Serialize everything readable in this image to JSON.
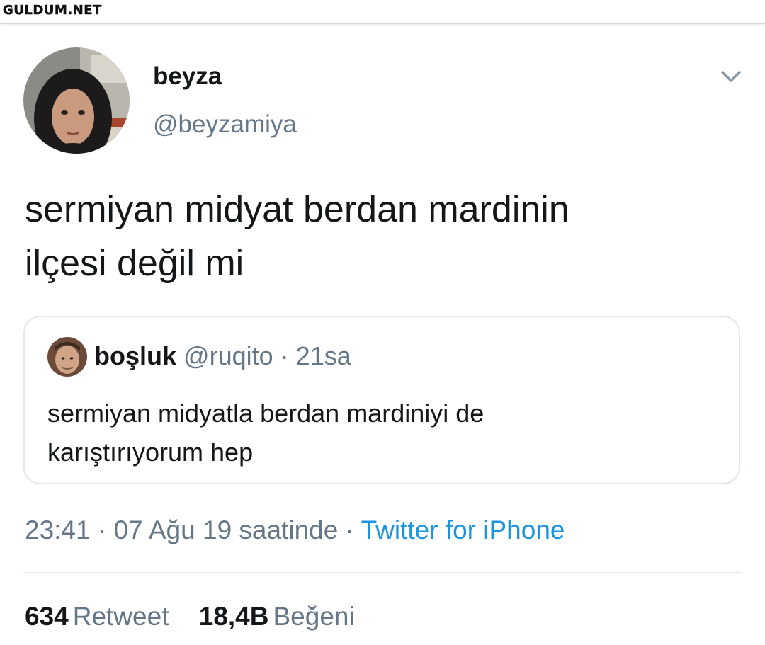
{
  "watermark": {
    "text": "GULDUM.NET"
  },
  "tweet": {
    "author": {
      "name": "beyza",
      "handle": "@beyzamiya"
    },
    "text_line1": "sermiyan midyat berdan mardinin",
    "text_line2": "ilçesi değil mi",
    "quoted": {
      "name": "boşluk",
      "handle": "@ruqito",
      "separator": "·",
      "time": "21sa",
      "text_line1": "sermiyan midyatla berdan mardiniyi de",
      "text_line2": "karıştırıyorum hep"
    },
    "meta": {
      "time": "23:41",
      "sep1": "·",
      "date": "07 Ağu 19 saatinde",
      "sep2": "·",
      "source": "Twitter for iPhone"
    },
    "stats": {
      "retweets_count": "634",
      "retweets_label": "Retweet",
      "likes_count": "18,4B",
      "likes_label": "Beğeni"
    }
  },
  "icons": {
    "menu": "chevron-down-icon"
  },
  "colors": {
    "primary_text": "#14171a",
    "secondary_text": "#657786",
    "link": "#1b95e0",
    "border": "#e1e8ed"
  }
}
